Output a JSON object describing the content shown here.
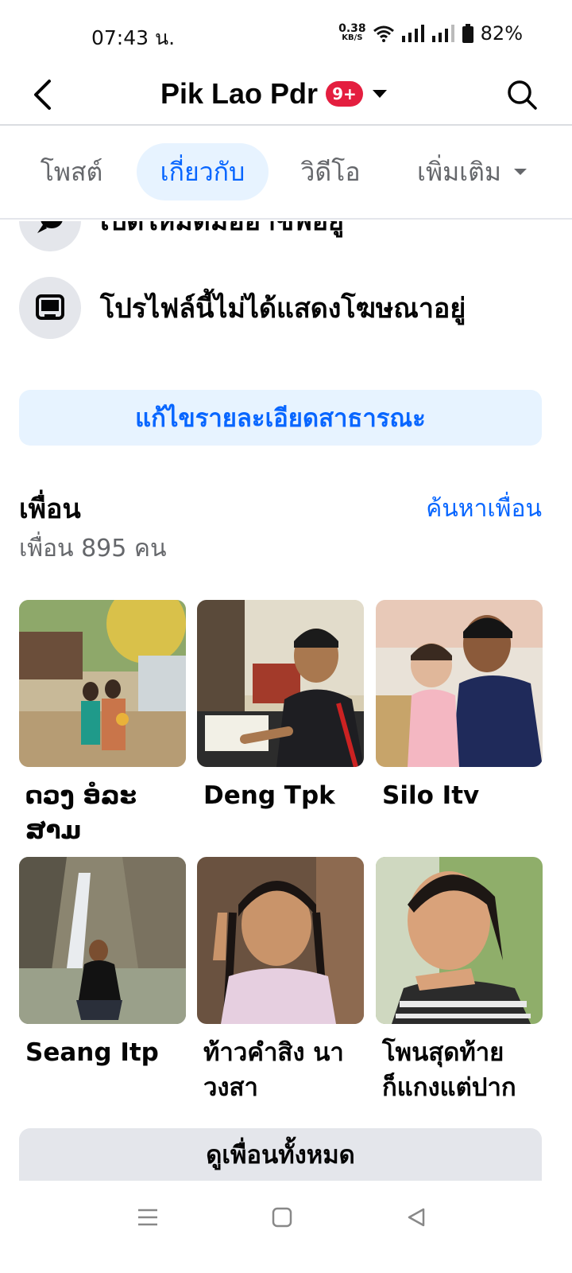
{
  "status_bar": {
    "time": "07:43 น.",
    "net_speed_value": "0.38",
    "net_speed_unit": "KB/S",
    "battery": "82%",
    "icons": [
      "wifi-icon",
      "signal-icon",
      "signal-icon",
      "battery-icon"
    ]
  },
  "header": {
    "title": "Pik Lao Pdr",
    "badge": "9+",
    "back_icon": "back-arrow-icon",
    "search_icon": "search-icon"
  },
  "tabs": [
    {
      "label": "โพสต์",
      "active": false
    },
    {
      "label": "เกี่ยวกับ",
      "active": true
    },
    {
      "label": "วิดีโอ",
      "active": false
    },
    {
      "label": "เพิ่มเติม",
      "active": false
    }
  ],
  "info_rows": [
    {
      "icon": "messenger-icon",
      "text": "เปิดใหม่ดีมีออาชีพอยู่"
    },
    {
      "icon": "ads-icon",
      "text": "โปรไฟล์นี้ไม่ได้แสดงโฆษณาอยู่"
    }
  ],
  "edit_button": "แก้ไขรายละเอียดสาธารณะ",
  "friends": {
    "heading": "เพื่อน",
    "find_link": "ค้นหาเพื่อน",
    "count_text": "เพื่อน 895 คน",
    "items": [
      {
        "name": "ດວງ ອໍລະ\nສາມ"
      },
      {
        "name": "Deng Tpk"
      },
      {
        "name": "Silo Itv"
      },
      {
        "name": "Seang Itp"
      },
      {
        "name": "ท้าวคำสิง นา\nวงสา"
      },
      {
        "name": "โพนสุดท้าย\nก็แกงแต่ปาก"
      }
    ],
    "see_all": "ดูเพื่อนทั้งหมด"
  },
  "nav_bar": [
    "menu-icon",
    "home-square-icon",
    "back-triangle-icon"
  ],
  "colors": {
    "accent": "#0866ff",
    "accent_bg": "#e7f3ff",
    "badge": "#e41e3f",
    "secondary_text": "#65676b",
    "button_grey": "#e4e6eb"
  }
}
